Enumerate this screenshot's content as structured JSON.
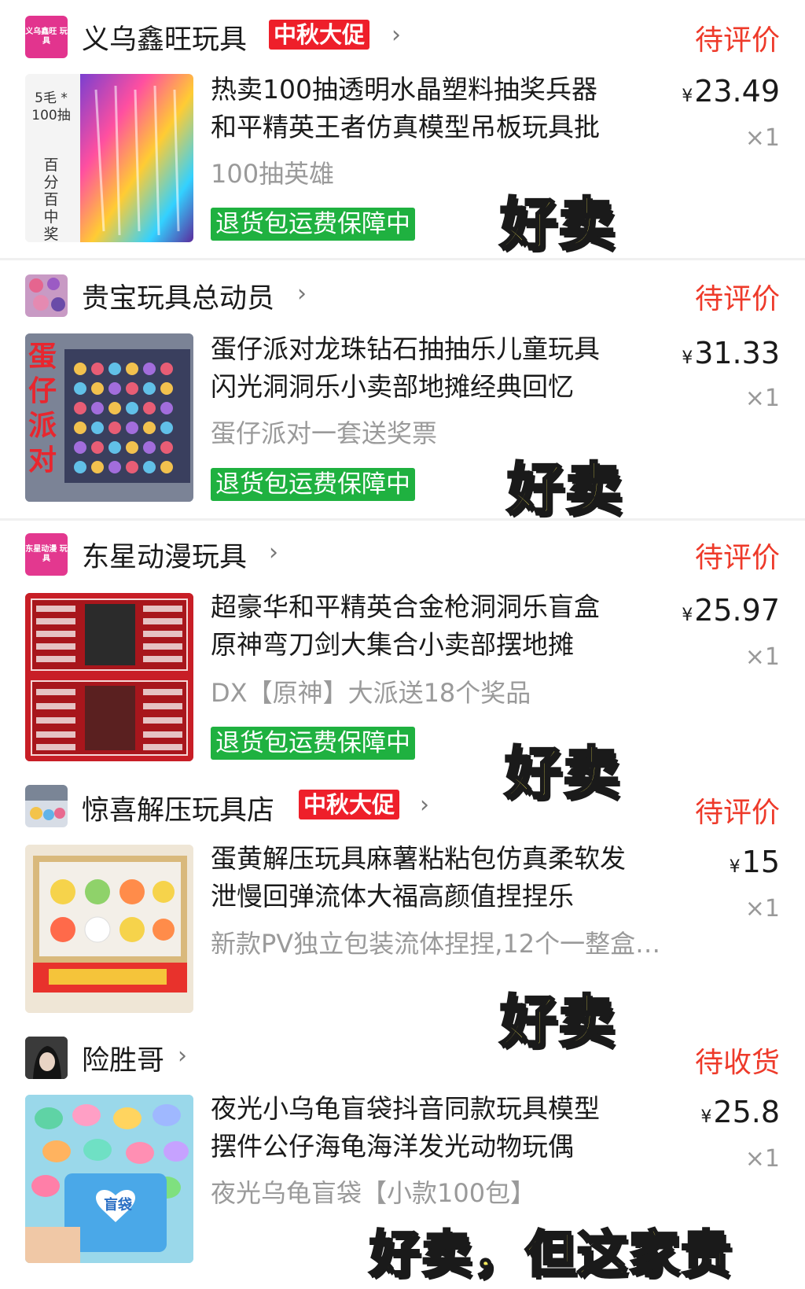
{
  "orders": [
    {
      "shop": {
        "name": "义乌鑫旺玩具",
        "avatar_text": "义乌鑫旺 玩具",
        "promo": "中秋大促"
      },
      "status": "待评价",
      "product": {
        "image_text_top": "5毛 * 100抽",
        "image_text_side": "百分百中奖",
        "title": "热卖100抽透明水晶塑料抽奖兵器\n和平精英王者仿真模型吊板玩具批",
        "spec": "100抽英雄",
        "guarantee": "退货包运费保障中",
        "price_symbol": "¥",
        "price": "23.49",
        "quantity": "×1"
      },
      "caption": "好卖"
    },
    {
      "shop": {
        "name": "贵宝玩具总动员",
        "avatar_text": "",
        "promo": ""
      },
      "status": "待评价",
      "product": {
        "image_text_side": "蛋仔派对",
        "title": "蛋仔派对龙珠钻石抽抽乐儿童玩具\n闪光洞洞乐小卖部地摊经典回忆",
        "spec": "蛋仔派对一套送奖票",
        "guarantee": "退货包运费保障中",
        "price_symbol": "¥",
        "price": "31.33",
        "quantity": "×1"
      },
      "caption": "好卖"
    },
    {
      "shop": {
        "name": "东星动漫玩具",
        "avatar_text": "东星动漫 玩具",
        "promo": ""
      },
      "status": "待评价",
      "product": {
        "title": "超豪华和平精英合金枪洞洞乐盲盒\n原神弯刀剑大集合小卖部摆地摊",
        "spec": "DX【原神】大派送18个奖品",
        "guarantee": "退货包运费保障中",
        "price_symbol": "¥",
        "price": "25.97",
        "quantity": "×1"
      },
      "caption": "好卖"
    },
    {
      "shop": {
        "name": "惊喜解压玩具店",
        "avatar_text": "",
        "promo": "中秋大促"
      },
      "status": "待评价",
      "product": {
        "title": "蛋黄解压玩具麻薯粘粘包仿真柔软发\n泄慢回弹流体大福高颜值捏捏乐",
        "spec": "新款PV独立包装流体捏捏,12个一整盒…",
        "guarantee": "",
        "price_symbol": "¥",
        "price": "15",
        "quantity": "×1"
      },
      "caption": "好卖"
    },
    {
      "shop": {
        "name": "险胜哥",
        "avatar_text": "",
        "promo": ""
      },
      "status": "待收货",
      "product": {
        "image_text": "盲袋",
        "title": "夜光小乌龟盲袋抖音同款玩具模型\n摆件公仔海龟海洋发光动物玩偶",
        "spec": "夜光乌龟盲袋【小款100包】",
        "guarantee": "",
        "price_symbol": "¥",
        "price": "25.8",
        "quantity": "×1"
      },
      "caption": "好卖，但这家贵"
    }
  ],
  "icons": {
    "chevron": "chevron-right-icon"
  },
  "colors": {
    "status": "#ee3a2a",
    "promo": "#ee1f2a",
    "guarantee": "#1fb140",
    "caption_fill": "#f7ea5a"
  }
}
